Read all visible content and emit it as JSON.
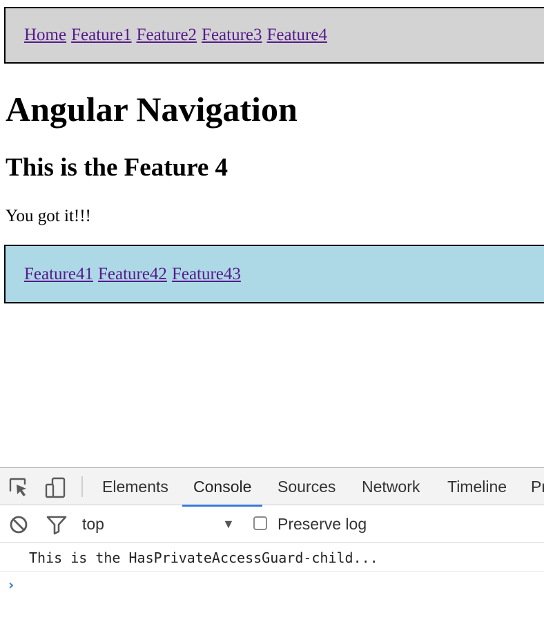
{
  "nav": {
    "links": [
      "Home",
      "Feature1",
      "Feature2",
      "Feature3",
      "Feature4"
    ]
  },
  "page": {
    "title": "Angular Navigation",
    "feature_heading": "This is the Feature 4",
    "feature_text": "You got it!!!"
  },
  "subnav": {
    "links": [
      "Feature41",
      "Feature42",
      "Feature43"
    ]
  },
  "devtools": {
    "tabs": [
      "Elements",
      "Console",
      "Sources",
      "Network",
      "Timeline",
      "Pr"
    ],
    "active_tab": "Console",
    "context": "top",
    "preserve_log_label": "Preserve log",
    "console_messages": [
      "This is the HasPrivateAccessGuard-child..."
    ],
    "prompt_symbol": "›"
  },
  "colors": {
    "nav_background": "#d3d3d3",
    "subnav_background": "#add8e6",
    "link": "#551a8b",
    "devtools_accent": "#3879d9"
  }
}
